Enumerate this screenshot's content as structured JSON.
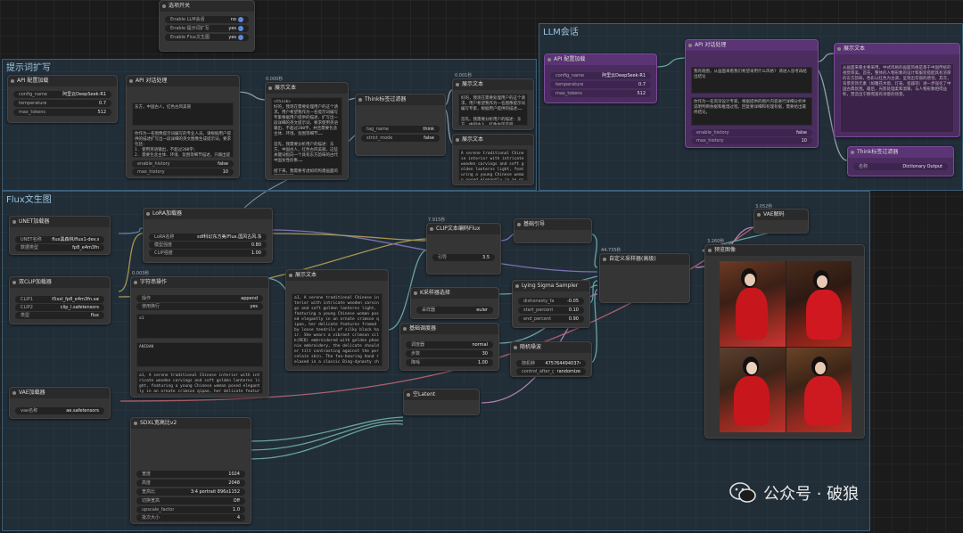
{
  "colors": {
    "group_border": "#3a5e78",
    "node_bg": "#353535",
    "llm_node": "#5a3475"
  },
  "groups": {
    "prompt": "提示词扩写",
    "flux": "Flux文生图",
    "llm": "LLM会话"
  },
  "top_node": {
    "title": "选项开关",
    "rows": [
      {
        "k": "Enable LLM会话",
        "v": "no"
      },
      {
        "k": "Enable 提示词扩写",
        "v": "yes"
      },
      {
        "k": "Enable Flux文生图",
        "v": "yes"
      }
    ]
  },
  "api_loader": {
    "title": "API 配置加载",
    "rows": [
      {
        "k": "config_name",
        "v": "阿里云DeepSeek-R1"
      },
      {
        "k": "temperature",
        "v": "0.7"
      },
      {
        "k": "max_tokens",
        "v": "512"
      }
    ]
  },
  "api_chat": {
    "title": "API 对话处理",
    "text1": "东方，中国古人，红色古风美丽",
    "text2": "你作为一名图像提示词编写的专业人员。请根据用户提供的描述扩写出一段详细的英文图像生成提示词，要求包括：\n1. 使用英语输出，不超过200字；\n2. 需要包含主体、环境、氛围等细节描述，只输出提示词本身。",
    "rows": [
      {
        "k": "enable_history",
        "v": "false"
      },
      {
        "k": "max_history",
        "v": "10"
      }
    ]
  },
  "display1": {
    "time": "0.000秒",
    "title": "展示文本",
    "text": "<think>\n好的，我现在需要处理用户的这个请求。用户希望我作为一名提示词编写专家根据用户提供的描述，扩写出一段详细的英文提示词，要求使用英语输出，不超过200字，并且需要包含主体、环境、氛围等细节……\n\n首先，我需要分析用户的描述：东方，中国古人，红色古风美丽。这些关键词指向一个具有东方韵味的古代中国女性形象……\n\n接下来，我需要考虑如何构建画面的环境和氛围……\n</think>"
  },
  "think_filter": {
    "title": "Think标签过滤器",
    "rows": [
      {
        "k": "tag_name",
        "v": "think"
      },
      {
        "k": "strict_mode",
        "v": "false"
      }
    ]
  },
  "display2": {
    "time": "0.001秒",
    "title": "展示文本",
    "text": "好的，我现在需要处理用户的这个请求。用户希望我作为一名图像提示词编写专家，根据用户提供的描述……\n\n首先，我需要分析用户的描述：东方，中国古人，红色古风美丽……"
  },
  "display3": {
    "title": "展示文本",
    "text": "A serene traditional Chinese interior with intricate wooden carvings and soft golden lanterns light, featuring a young Chinese woman posed elegantly in an ornate crimson qipao ..."
  },
  "unet": {
    "title": "UNET加载器",
    "rows": [
      {
        "k": "UNET名称",
        "v": "flux黑森林/flux1-dev.sft"
      },
      {
        "k": "数据类型",
        "v": "fp8_e4m3fn"
      }
    ]
  },
  "dual_clip": {
    "title": "双CLIP加载器",
    "rows": [
      {
        "k": "CLIP1",
        "v": "t5xxl_fp8_e4m3fn.safetensors"
      },
      {
        "k": "CLIP2",
        "v": "clip_l.safetensors"
      },
      {
        "k": "类型",
        "v": "flux"
      }
    ]
  },
  "vae_loader": {
    "title": "VAE加载器",
    "rows": [
      {
        "k": "vae名称",
        "v": "ae.safetensors"
      }
    ]
  },
  "lora": {
    "title": "LoRA加载器",
    "rows": [
      {
        "k": "LoRA名称",
        "v": "sdf科幻东方美/Flux.国风古风.东方时代红宫女.s"
      },
      {
        "k": "模型强度",
        "v": "0.80"
      },
      {
        "k": "CLIP强度",
        "v": "1.00"
      }
    ]
  },
  "string_op": {
    "time": "0.003秒",
    "title": "字符串操作",
    "rows": [
      {
        "k": "操作",
        "v": "append"
      },
      {
        "k": "使用换行",
        "v": "yes"
      }
    ],
    "box1": "a1",
    "box2": "ANIBAN",
    "text": "a1, A serene traditional Chinese interior with intricate wooden carvings and soft golden lanterns light, featuring a young Chinese woman posed elegantly in an ornate crimson qipao, her delicate features framed by loose tendrils of silky black hair."
  },
  "display4": {
    "title": "展示文本",
    "text": "a1, A serene traditional Chinese interior with intricate wooden carvings and soft golden lanterns light, featuring a young Chinese woman posed elegantly in an ornate crimson qipao, her delicate features framed by loose tendrils of silky black hair. She wears a vibrant crimson silk(RED) embroidered with golden phoenix embroidery, the delicate shoulder tilt contrasting against the porcelain skin. The fan-bearing hand relaxed in a classic Bing-dynasty chair with jade accents."
  },
  "clip_encode": {
    "time": "7.915秒",
    "title": "CLIP文本编码Flux",
    "rows": [
      {
        "k": "引导",
        "v": "3.5"
      }
    ]
  },
  "basic_guider": {
    "title": "基础引导"
  },
  "sampler_select": {
    "title": "K采样器选择",
    "rows": [
      {
        "k": "采样器",
        "v": "euler"
      }
    ]
  },
  "lying_sigma": {
    "title": "Lying Sigma Sampler",
    "rows": [
      {
        "k": "dishonesty_factor",
        "v": "-0.05"
      },
      {
        "k": "start_percent",
        "v": "0.10"
      },
      {
        "k": "end_percent",
        "v": "0.90"
      }
    ]
  },
  "basic_sched": {
    "title": "基础调度器",
    "rows": [
      {
        "k": "调度器",
        "v": "normal"
      },
      {
        "k": "步数",
        "v": "30"
      },
      {
        "k": "降噪",
        "v": "1.00"
      }
    ]
  },
  "random_noise": {
    "title": "随机噪波",
    "rows": [
      {
        "k": "随机种",
        "v": "475764494037419"
      },
      {
        "k": "control_after_generate",
        "v": "randomize"
      }
    ]
  },
  "custom_sampler": {
    "time": "44.735秒",
    "title": "自定义采样器(高级)"
  },
  "vae_decode": {
    "time": "3.052秒",
    "title": "VAE解码"
  },
  "preview": {
    "time": "3.260秒",
    "title": "预览图像"
  },
  "empty_latent": {
    "title": "空Latent"
  },
  "sdxl_res": {
    "title": "SDXL宽高比v2",
    "rows": [
      {
        "k": "宽度",
        "v": "1024"
      },
      {
        "k": "高度",
        "v": "2048"
      },
      {
        "k": "宽高比",
        "v": "3:4 portrait 896x1152"
      },
      {
        "k": "切换宽高",
        "v": "Off"
      },
      {
        "k": "upscale_factor",
        "v": "1.0"
      },
      {
        "k": "批次大小",
        "v": "4"
      }
    ]
  },
  "llm_loader": {
    "title": "API 配置加载",
    "rows": [
      {
        "k": "config_name",
        "v": "阿里云DeepSeek-R1"
      },
      {
        "k": "temperature",
        "v": "0.7"
      },
      {
        "k": "max_tokens",
        "v": "512"
      }
    ]
  },
  "llm_chat": {
    "title": "API 对话处理",
    "text1": "我有跑图，从画面来看我们希望采用什么风格? 请进入思考再给出结论",
    "text2": "你作为一名资深设计专家，根据提供的图片内容进行详细分析并说明判断依据和推理过程。回复要详细和有理有据，需要给出最终结论。",
    "rows": [
      {
        "k": "enable_history",
        "v": "false"
      },
      {
        "k": "max_history",
        "v": "10"
      }
    ]
  },
  "llm_display": {
    "title": "展示文本",
    "text": "从画面来看主要采用，中式风格的画面风格是基于中国传统的视觉审美。首先，整体的人物形象的设计和服装搭配具有浓厚的东方韵味，色彩以红色为主调，呈现出华丽的感觉。其次，背景装饰元素（如雕花木窗、灯笼、瓷器等）进一步强化了中国古典氛围。最后，光影处理柔和温暖，与人物形象相得益彰，营造出宁静而富有诗意的场景。"
  },
  "llm_think": {
    "title": "Think标签过滤器",
    "rows": [
      {
        "k": "名称",
        "v": "Dictionary Output"
      }
    ]
  },
  "watermark": "公众号 · 破狼"
}
